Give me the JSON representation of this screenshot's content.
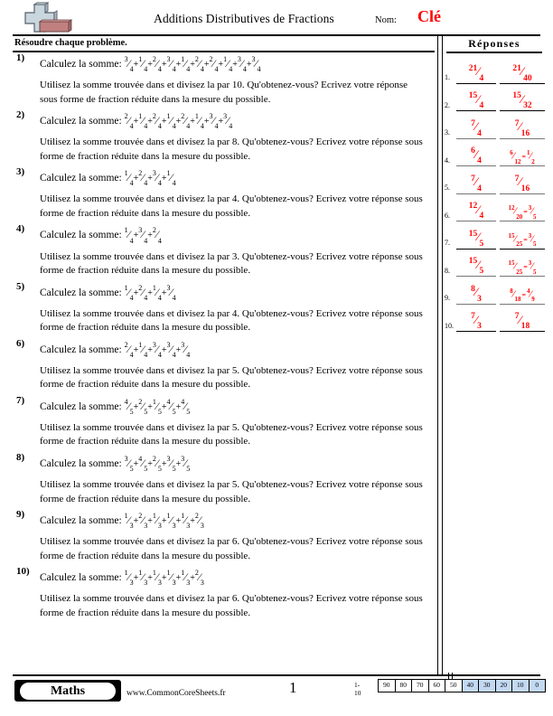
{
  "header": {
    "title": "Additions Distributives de Fractions",
    "name_label": "Nom:",
    "name_value": "Clé",
    "logo_icon": "plus-block-icon"
  },
  "instruction": "Résoudre chaque problème.",
  "answers_header": "Réponses",
  "problems": [
    {
      "num": "1)",
      "prompt": "Calculez la somme:",
      "fractions": [
        {
          "n": "3",
          "d": "4"
        },
        {
          "n": "1",
          "d": "4"
        },
        {
          "n": "2",
          "d": "4"
        },
        {
          "n": "3",
          "d": "4"
        },
        {
          "n": "1",
          "d": "4"
        },
        {
          "n": "2",
          "d": "4"
        },
        {
          "n": "2",
          "d": "4"
        },
        {
          "n": "1",
          "d": "4"
        },
        {
          "n": "3",
          "d": "4"
        },
        {
          "n": "3",
          "d": "4"
        }
      ],
      "instr": "Utilisez la somme trouvée dans et divisez la par 10. Qu'obtenez-vous? Ecrivez votre réponse sous forme de fraction réduite dans la mesure du possible.",
      "divisor": "10"
    },
    {
      "num": "2)",
      "prompt": "Calculez la somme:",
      "fractions": [
        {
          "n": "2",
          "d": "4"
        },
        {
          "n": "1",
          "d": "4"
        },
        {
          "n": "2",
          "d": "4"
        },
        {
          "n": "1",
          "d": "4"
        },
        {
          "n": "2",
          "d": "4"
        },
        {
          "n": "1",
          "d": "4"
        },
        {
          "n": "3",
          "d": "4"
        },
        {
          "n": "3",
          "d": "4"
        }
      ],
      "instr": "Utilisez la somme trouvée dans et divisez la par 8. Qu'obtenez-vous? Ecrivez votre réponse sous forme de fraction réduite dans la mesure du possible.",
      "divisor": "8"
    },
    {
      "num": "3)",
      "prompt": "Calculez la somme:",
      "fractions": [
        {
          "n": "1",
          "d": "4"
        },
        {
          "n": "2",
          "d": "4"
        },
        {
          "n": "3",
          "d": "4"
        },
        {
          "n": "1",
          "d": "4"
        }
      ],
      "instr": "Utilisez la somme trouvée dans et divisez la par 4. Qu'obtenez-vous? Ecrivez votre réponse sous forme de fraction réduite dans la mesure du possible.",
      "divisor": "4"
    },
    {
      "num": "4)",
      "prompt": "Calculez la somme:",
      "fractions": [
        {
          "n": "1",
          "d": "4"
        },
        {
          "n": "3",
          "d": "4"
        },
        {
          "n": "2",
          "d": "4"
        }
      ],
      "instr": "Utilisez la somme trouvée dans et divisez la par 3. Qu'obtenez-vous? Ecrivez votre réponse sous forme de fraction réduite dans la mesure du possible.",
      "divisor": "3"
    },
    {
      "num": "5)",
      "prompt": "Calculez la somme:",
      "fractions": [
        {
          "n": "1",
          "d": "4"
        },
        {
          "n": "2",
          "d": "4"
        },
        {
          "n": "1",
          "d": "4"
        },
        {
          "n": "3",
          "d": "4"
        }
      ],
      "instr": "Utilisez la somme trouvée dans et divisez la par 4. Qu'obtenez-vous? Ecrivez votre réponse sous forme de fraction réduite dans la mesure du possible.",
      "divisor": "4"
    },
    {
      "num": "6)",
      "prompt": "Calculez la somme:",
      "fractions": [
        {
          "n": "2",
          "d": "4"
        },
        {
          "n": "1",
          "d": "4"
        },
        {
          "n": "3",
          "d": "4"
        },
        {
          "n": "3",
          "d": "4"
        },
        {
          "n": "3",
          "d": "4"
        }
      ],
      "instr": "Utilisez la somme trouvée dans et divisez la par 5. Qu'obtenez-vous? Ecrivez votre réponse sous forme de fraction réduite dans la mesure du possible.",
      "divisor": "5"
    },
    {
      "num": "7)",
      "prompt": "Calculez la somme:",
      "fractions": [
        {
          "n": "4",
          "d": "5"
        },
        {
          "n": "2",
          "d": "5"
        },
        {
          "n": "1",
          "d": "5"
        },
        {
          "n": "4",
          "d": "5"
        },
        {
          "n": "4",
          "d": "5"
        }
      ],
      "instr": "Utilisez la somme trouvée dans et divisez la par 5. Qu'obtenez-vous? Ecrivez votre réponse sous forme de fraction réduite dans la mesure du possible.",
      "divisor": "5"
    },
    {
      "num": "8)",
      "prompt": "Calculez la somme:",
      "fractions": [
        {
          "n": "3",
          "d": "5"
        },
        {
          "n": "4",
          "d": "5"
        },
        {
          "n": "2",
          "d": "5"
        },
        {
          "n": "3",
          "d": "5"
        },
        {
          "n": "3",
          "d": "5"
        }
      ],
      "instr": "Utilisez la somme trouvée dans et divisez la par 5. Qu'obtenez-vous? Ecrivez votre réponse sous forme de fraction réduite dans la mesure du possible.",
      "divisor": "5"
    },
    {
      "num": "9)",
      "prompt": "Calculez la somme:",
      "fractions": [
        {
          "n": "1",
          "d": "3"
        },
        {
          "n": "2",
          "d": "3"
        },
        {
          "n": "1",
          "d": "3"
        },
        {
          "n": "1",
          "d": "3"
        },
        {
          "n": "1",
          "d": "3"
        },
        {
          "n": "2",
          "d": "3"
        }
      ],
      "instr": "Utilisez la somme trouvée dans et divisez la par 6. Qu'obtenez-vous? Ecrivez votre réponse sous forme de fraction réduite dans la mesure du possible.",
      "divisor": "6"
    },
    {
      "num": "10)",
      "prompt": "Calculez la somme:",
      "fractions": [
        {
          "n": "1",
          "d": "3"
        },
        {
          "n": "1",
          "d": "3"
        },
        {
          "n": "1",
          "d": "3"
        },
        {
          "n": "1",
          "d": "3"
        },
        {
          "n": "1",
          "d": "3"
        },
        {
          "n": "2",
          "d": "3"
        }
      ],
      "instr": "Utilisez la somme trouvée dans et divisez la par 6. Qu'obtenez-vous? Ecrivez votre réponse sous forme de fraction réduite dans la mesure du possible.",
      "divisor": "6"
    }
  ],
  "answers": [
    {
      "idx": "1.",
      "sum": {
        "n": "21",
        "d": "4"
      },
      "result": {
        "n": "21",
        "d": "40"
      },
      "reduced": null,
      "rule": "black"
    },
    {
      "idx": "2.",
      "sum": {
        "n": "15",
        "d": "4"
      },
      "result": {
        "n": "15",
        "d": "32"
      },
      "reduced": null,
      "rule": "black"
    },
    {
      "idx": "3.",
      "sum": {
        "n": "7",
        "d": "4"
      },
      "result": {
        "n": "7",
        "d": "16"
      },
      "reduced": null,
      "rule": "gray"
    },
    {
      "idx": "4.",
      "sum": {
        "n": "6",
        "d": "4"
      },
      "result": {
        "n": "6",
        "d": "12"
      },
      "reduced": {
        "n": "1",
        "d": "2"
      },
      "rule": "gray"
    },
    {
      "idx": "5.",
      "sum": {
        "n": "7",
        "d": "4"
      },
      "result": {
        "n": "7",
        "d": "16"
      },
      "reduced": null,
      "rule": "gray"
    },
    {
      "idx": "6.",
      "sum": {
        "n": "12",
        "d": "4"
      },
      "result": {
        "n": "12",
        "d": "20"
      },
      "reduced": {
        "n": "3",
        "d": "5"
      },
      "rule": "gray"
    },
    {
      "idx": "7.",
      "sum": {
        "n": "15",
        "d": "5"
      },
      "result": {
        "n": "15",
        "d": "25"
      },
      "reduced": {
        "n": "3",
        "d": "5"
      },
      "rule": "black"
    },
    {
      "idx": "8.",
      "sum": {
        "n": "15",
        "d": "5"
      },
      "result": {
        "n": "15",
        "d": "25"
      },
      "reduced": {
        "n": "3",
        "d": "5"
      },
      "rule": "gray"
    },
    {
      "idx": "9.",
      "sum": {
        "n": "8",
        "d": "3"
      },
      "result": {
        "n": "8",
        "d": "18"
      },
      "reduced": {
        "n": "4",
        "d": "9"
      },
      "rule": "gray"
    },
    {
      "idx": "10.",
      "sum": {
        "n": "7",
        "d": "3"
      },
      "result": {
        "n": "7",
        "d": "18"
      },
      "reduced": null,
      "rule": "black"
    }
  ],
  "footer": {
    "brand": "Maths",
    "url": "www.CommonCoreSheets.fr",
    "page_number": "1",
    "scale_label": "1-10",
    "scale_values": [
      "90",
      "80",
      "70",
      "60",
      "50",
      "40",
      "30",
      "20",
      "10",
      "0"
    ],
    "scale_highlight_from_index": 5,
    "highlight_color": "#c3d9f2"
  },
  "colors": {
    "answer_red": "#ff0000",
    "rule_black": "#000000",
    "rule_gray": "#777777"
  }
}
